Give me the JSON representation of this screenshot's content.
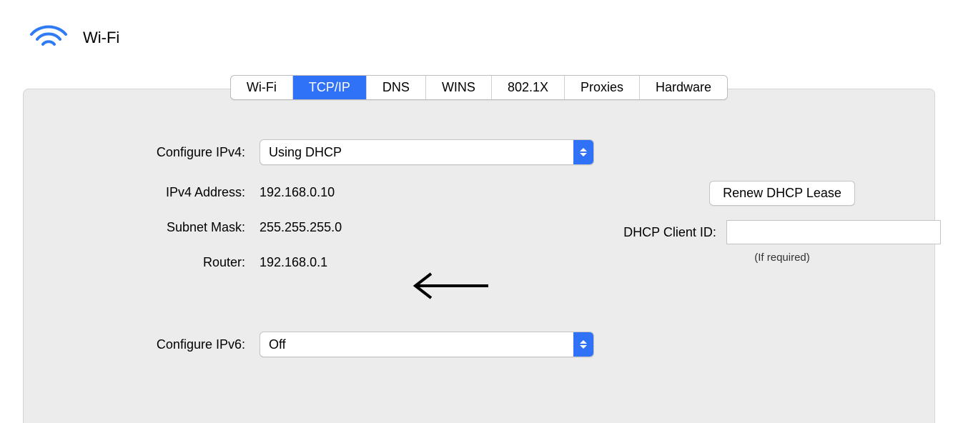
{
  "header": {
    "title": "Wi-Fi"
  },
  "tabs": [
    {
      "label": "Wi-Fi",
      "selected": false
    },
    {
      "label": "TCP/IP",
      "selected": true
    },
    {
      "label": "DNS",
      "selected": false
    },
    {
      "label": "WINS",
      "selected": false
    },
    {
      "label": "802.1X",
      "selected": false
    },
    {
      "label": "Proxies",
      "selected": false
    },
    {
      "label": "Hardware",
      "selected": false
    }
  ],
  "form": {
    "configure_ipv4_label": "Configure IPv4:",
    "configure_ipv4_value": "Using DHCP",
    "ipv4_address_label": "IPv4 Address:",
    "ipv4_address_value": "192.168.0.10",
    "subnet_mask_label": "Subnet Mask:",
    "subnet_mask_value": "255.255.255.0",
    "router_label": "Router:",
    "router_value": "192.168.0.1",
    "configure_ipv6_label": "Configure IPv6:",
    "configure_ipv6_value": "Off"
  },
  "right": {
    "renew_button": "Renew DHCP Lease",
    "dhcp_client_id_label": "DHCP Client ID:",
    "dhcp_client_id_value": "",
    "required_note": "(If required)"
  }
}
